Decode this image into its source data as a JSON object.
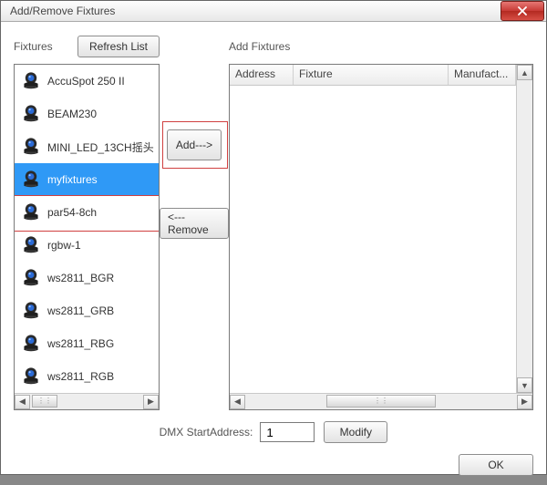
{
  "window": {
    "title": "Add/Remove Fixtures"
  },
  "left": {
    "label": "Fixtures",
    "refresh_label": "Refresh List",
    "items": [
      {
        "label": "AccuSpot 250 II",
        "selected": false
      },
      {
        "label": "BEAM230",
        "selected": false
      },
      {
        "label": "MINI_LED_13CH摇头",
        "selected": false
      },
      {
        "label": "myfixtures",
        "selected": true
      },
      {
        "label": "par54-8ch",
        "selected": false
      },
      {
        "label": "rgbw-1",
        "selected": false
      },
      {
        "label": "ws2811_BGR",
        "selected": false
      },
      {
        "label": "ws2811_GRB",
        "selected": false
      },
      {
        "label": "ws2811_RBG",
        "selected": false
      },
      {
        "label": "ws2811_RGB",
        "selected": false
      }
    ]
  },
  "mid": {
    "add_label": "Add--->",
    "remove_label": "<---Remove"
  },
  "right": {
    "label": "Add Fixtures",
    "columns": [
      "Address",
      "Fixture",
      "Manufact..."
    ],
    "rows": []
  },
  "bottom": {
    "dmx_label": "DMX StartAddress:",
    "dmx_value": "1",
    "modify_label": "Modify",
    "ok_label": "OK"
  },
  "icons": {
    "fixture_icon": "moving-head-icon"
  }
}
